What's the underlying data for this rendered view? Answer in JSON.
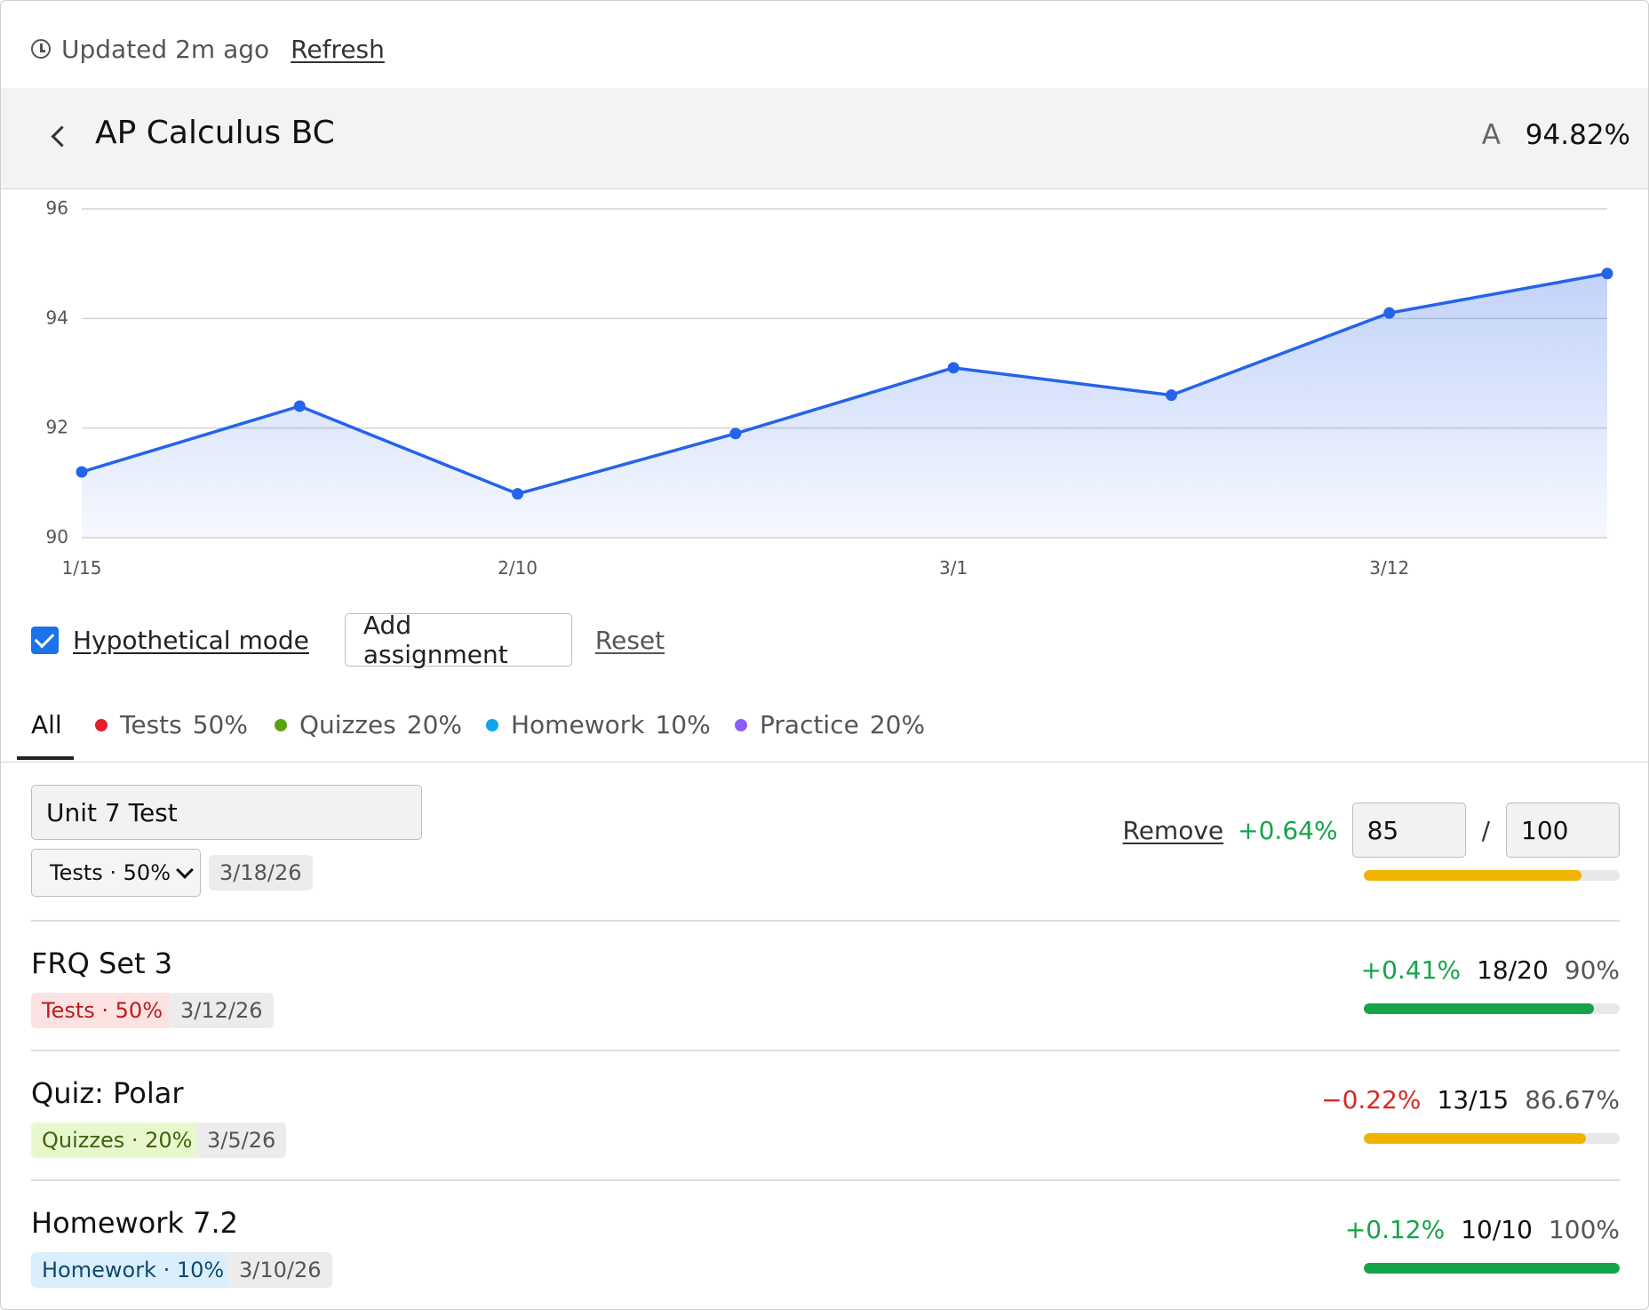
{
  "status": {
    "updated": "Updated 2m ago",
    "refresh": "Refresh"
  },
  "course": {
    "title": "AP Calculus BC",
    "letter": "A",
    "percent": "94.82%"
  },
  "chart_data": {
    "type": "area",
    "x": [
      "1/15",
      "",
      "2/10",
      "",
      "3/1",
      "",
      "3/12",
      ""
    ],
    "xtick_labels": [
      "1/15",
      "2/10",
      "3/1",
      "3/12"
    ],
    "values": [
      91.2,
      92.4,
      90.8,
      91.9,
      93.1,
      92.6,
      94.1,
      94.82
    ],
    "ylim": [
      90,
      96
    ],
    "yticks": [
      90,
      92,
      94,
      96
    ],
    "grid": true,
    "color": "#2563eb"
  },
  "controls": {
    "hypothetical_label": "Hypothetical mode",
    "hypothetical_checked": true,
    "add_label": "Add assignment",
    "reset_label": "Reset"
  },
  "tabs": [
    {
      "label": "All",
      "weight": "",
      "color": ""
    },
    {
      "label": "Tests",
      "weight": "50%",
      "color": "#e11d2e"
    },
    {
      "label": "Quizzes",
      "weight": "20%",
      "color": "#5aa30e"
    },
    {
      "label": "Homework",
      "weight": "10%",
      "color": "#0ea5e9"
    },
    {
      "label": "Practice",
      "weight": "20%",
      "color": "#8b5cf6"
    }
  ],
  "hypothetical": {
    "name_value": "Unit 7 Test",
    "category": "Tests · 50%",
    "date": "3/18/26",
    "remove": "Remove",
    "delta": "+0.64%",
    "score": "85",
    "total": "100",
    "slash": "/",
    "fraction": 0.85,
    "bar_color": "#f0b400"
  },
  "assignments": [
    {
      "name": "FRQ Set 3",
      "category": "Tests · 50%",
      "cat_bg": "#fde2e2",
      "cat_fg": "#b91c1c",
      "date": "3/12/26",
      "delta": "+0.41%",
      "delta_sign": "pos",
      "score": "18/20",
      "percent": "90%",
      "fraction": 0.9,
      "bar_color": "#16a34a"
    },
    {
      "name": "Quiz: Polar",
      "category": "Quizzes · 20%",
      "cat_bg": "#e8f8cc",
      "cat_fg": "#3f6212",
      "date": "3/5/26",
      "delta": "−0.22%",
      "delta_sign": "neg",
      "score": "13/15",
      "percent": "86.67%",
      "fraction": 0.8667,
      "bar_color": "#f0b400"
    },
    {
      "name": "Homework 7.2",
      "category": "Homework · 10%",
      "cat_bg": "#dbeefc",
      "cat_fg": "#0c4a6e",
      "date": "3/10/26",
      "delta": "+0.12%",
      "delta_sign": "pos",
      "score": "10/10",
      "percent": "100%",
      "fraction": 1.0,
      "bar_color": "#16a34a"
    }
  ]
}
